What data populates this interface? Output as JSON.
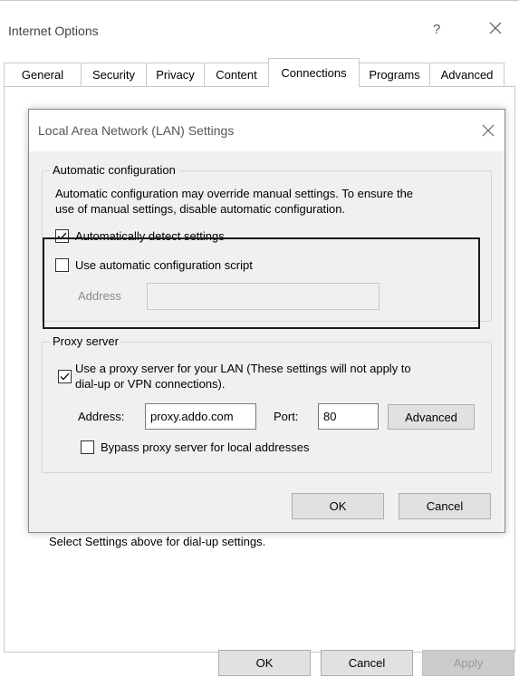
{
  "outer_window": {
    "title": "Internet Options",
    "help_glyph": "?",
    "tabs": [
      {
        "label": "General"
      },
      {
        "label": "Security"
      },
      {
        "label": "Privacy"
      },
      {
        "label": "Content"
      },
      {
        "label": "Connections",
        "active": true
      },
      {
        "label": "Programs"
      },
      {
        "label": "Advanced"
      }
    ],
    "hint_text": "Select Settings above for dial-up settings.",
    "buttons": {
      "ok": "OK",
      "cancel": "Cancel",
      "apply": "Apply"
    }
  },
  "lan_dialog": {
    "title": "Local Area Network (LAN) Settings",
    "auto_config": {
      "group_label": "Automatic configuration",
      "description_line1": "Automatic configuration may override manual settings.  To ensure the",
      "description_line2": "use of manual settings, disable automatic configuration.",
      "detect_settings_label": "Automatically detect settings",
      "detect_settings_checked": true,
      "use_script_label": "Use automatic configuration script",
      "use_script_checked": false,
      "address_label": "Address",
      "address_value": ""
    },
    "proxy": {
      "group_label": "Proxy server",
      "use_proxy_label_line1": "Use a proxy server for your LAN (These settings will not apply to",
      "use_proxy_label_line2": "dial-up or VPN connections).",
      "use_proxy_checked": true,
      "address_label": "Address:",
      "address_value": "proxy.addo.com",
      "port_label": "Port:",
      "port_value": "80",
      "advanced_button": "Advanced",
      "bypass_label": "Bypass proxy server for local addresses",
      "bypass_checked": false
    },
    "buttons": {
      "ok": "OK",
      "cancel": "Cancel"
    }
  }
}
